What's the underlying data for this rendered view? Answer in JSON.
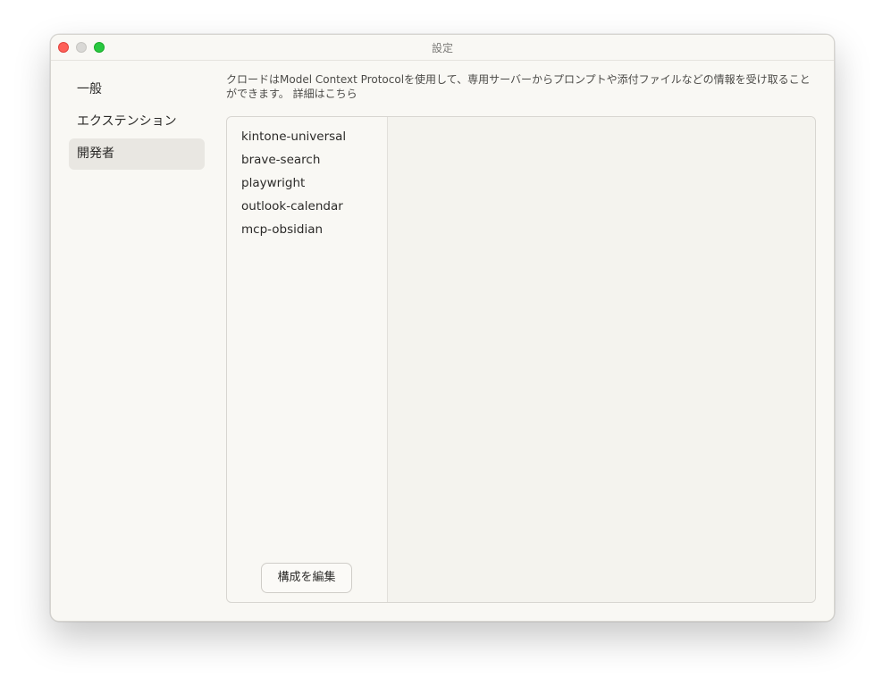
{
  "window": {
    "title": "設定"
  },
  "sidebar": {
    "items": [
      {
        "label": "一般"
      },
      {
        "label": "エクステンション"
      },
      {
        "label": "開発者"
      }
    ]
  },
  "content": {
    "description": "クロードはModel Context Protocolを使用して、専用サーバーからプロンプトや添付ファイルなどの情報を受け取ることができます。",
    "details_link": "詳細はこちら"
  },
  "servers": {
    "items": [
      {
        "name": "kintone-universal"
      },
      {
        "name": "brave-search"
      },
      {
        "name": "playwright"
      },
      {
        "name": "outlook-calendar"
      },
      {
        "name": "mcp-obsidian"
      }
    ],
    "edit_label": "構成を編集"
  },
  "colors": {
    "close": "#fe5f57",
    "minimize": "#d9d8d5",
    "maximize": "#28c840",
    "window_bg": "#f9f8f4",
    "active_item": "#e9e7e2"
  }
}
